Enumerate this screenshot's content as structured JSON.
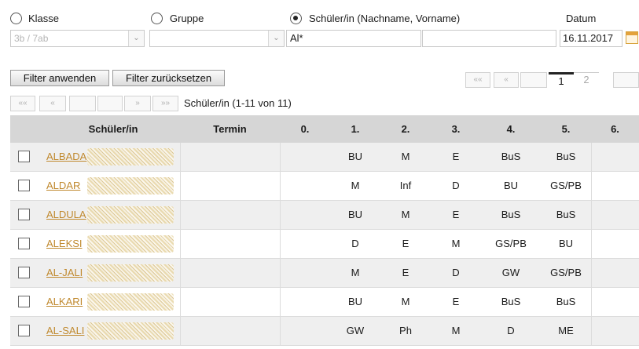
{
  "filters": {
    "radio_klasse": "Klasse",
    "radio_gruppe": "Gruppe",
    "radio_schueler": "Schüler/in (Nachname, Vorname)",
    "datum_label": "Datum",
    "klasse_value": "3b / 7ab",
    "gruppe_value": "",
    "name_value": "Al*",
    "extra_value": "",
    "date_value": "16.11.2017",
    "selected": "schueler"
  },
  "buttons": {
    "apply": "Filter anwenden",
    "reset": "Filter zurücksetzen"
  },
  "pager_top": {
    "first": "««",
    "prev": "«",
    "page1": "1",
    "page2": "2"
  },
  "pager_list": {
    "first": "««",
    "prev": "«",
    "next": "»",
    "last": "»»",
    "summary": "Schüler/in (1-11 von 11)"
  },
  "table": {
    "columns": [
      "Schüler/in",
      "Termin",
      "0.",
      "1.",
      "2.",
      "3.",
      "4.",
      "5.",
      "6."
    ],
    "rows": [
      {
        "name": "ALBADA",
        "periods": [
          "",
          "BU",
          "M",
          "E",
          "BuS",
          "BuS",
          ""
        ]
      },
      {
        "name": "ALDAR",
        "periods": [
          "",
          "M",
          "Inf",
          "D",
          "BU",
          "GS/PB",
          ""
        ]
      },
      {
        "name": "ALDULA",
        "periods": [
          "",
          "BU",
          "M",
          "E",
          "BuS",
          "BuS",
          ""
        ]
      },
      {
        "name": "ALEKSI",
        "periods": [
          "",
          "D",
          "E",
          "M",
          "GS/PB",
          "BU",
          ""
        ]
      },
      {
        "name": "AL-JALI",
        "periods": [
          "",
          "M",
          "E",
          "D",
          "GW",
          "GS/PB",
          ""
        ]
      },
      {
        "name": "ALKARI",
        "periods": [
          "",
          "BU",
          "M",
          "E",
          "BuS",
          "BuS",
          ""
        ]
      },
      {
        "name": "AL-SALI",
        "periods": [
          "",
          "GW",
          "Ph",
          "M",
          "D",
          "ME",
          ""
        ]
      }
    ]
  }
}
